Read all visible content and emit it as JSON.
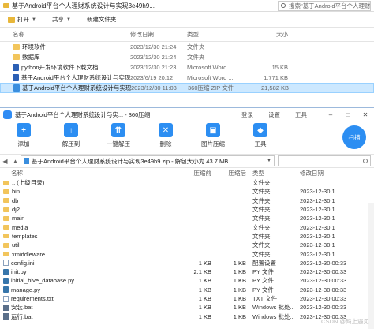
{
  "explorer": {
    "title": "基于Android平台个人理财系统设计与实现3e49h9...",
    "search_placeholder": "搜索\"基于Android平台个人理财系统...",
    "toolbar": {
      "open": "打开",
      "share": "共享",
      "new_folder": "新建文件夹"
    },
    "columns": {
      "name": "名称",
      "date": "修改日期",
      "type": "类型",
      "size": "大小"
    },
    "rows": [
      {
        "name": "环境软件",
        "date": "2023/12/30 21:24",
        "type": "文件夹",
        "size": "",
        "icon": "folder-icon"
      },
      {
        "name": "数据库",
        "date": "2023/12/30 21:24",
        "type": "文件夹",
        "size": "",
        "icon": "folder-icon"
      },
      {
        "name": "python开发环境软件下载文档",
        "date": "2023/12/30 21:23",
        "type": "Microsoft Word ...",
        "size": "15 KB",
        "icon": "word-icon"
      },
      {
        "name": "基于Android平台个人理财系统设计与实现...",
        "date": "2023/6/19 20:12",
        "type": "Microsoft Word ...",
        "size": "1,771 KB",
        "icon": "word-icon"
      },
      {
        "name": "基于Android平台个人理财系统设计与实现...",
        "date": "2023/12/30 11:03",
        "type": "360压缩 ZIP 文件",
        "size": "21,582 KB",
        "icon": "zip-icon",
        "selected": true
      }
    ]
  },
  "zip": {
    "title": "基于Android平台个人理财系统设计与实... - 360压缩",
    "menu": {
      "login": "登录",
      "settings": "设置",
      "tools": "工具"
    },
    "toolbar": [
      {
        "label": "添加",
        "icon": "add-icon"
      },
      {
        "label": "解压到",
        "icon": "extract-to-icon"
      },
      {
        "label": "一键解压",
        "icon": "one-click-extract-icon"
      },
      {
        "label": "删除",
        "icon": "delete-icon"
      },
      {
        "label": "图片压缩",
        "icon": "image-compress-icon"
      },
      {
        "label": "工具",
        "icon": "tools-icon"
      }
    ],
    "scan_label": "扫描",
    "path": "基于Android平台个人理财系统设计与实现3e49h9.zip - 解包大小为 43.7 MB",
    "columns": {
      "name": "名称",
      "compressed": "压缩前",
      "original": "压缩后",
      "type": "类型",
      "modified": "修改日期"
    },
    "rows": [
      {
        "name": ".. (上级目录)",
        "compressed": "",
        "original": "",
        "type": "文件夹",
        "modified": "",
        "icon": "folder"
      },
      {
        "name": "bin",
        "compressed": "",
        "original": "",
        "type": "文件夹",
        "modified": "2023-12-30 1",
        "icon": "folder"
      },
      {
        "name": "db",
        "compressed": "",
        "original": "",
        "type": "文件夹",
        "modified": "2023-12-30 1",
        "icon": "folder"
      },
      {
        "name": "dj2",
        "compressed": "",
        "original": "",
        "type": "文件夹",
        "modified": "2023-12-30 1",
        "icon": "folder"
      },
      {
        "name": "main",
        "compressed": "",
        "original": "",
        "type": "文件夹",
        "modified": "2023-12-30 1",
        "icon": "folder"
      },
      {
        "name": "media",
        "compressed": "",
        "original": "",
        "type": "文件夹",
        "modified": "2023-12-30 1",
        "icon": "folder"
      },
      {
        "name": "templates",
        "compressed": "",
        "original": "",
        "type": "文件夹",
        "modified": "2023-12-30 1",
        "icon": "folder"
      },
      {
        "name": "util",
        "compressed": "",
        "original": "",
        "type": "文件夹",
        "modified": "2023-12-30 1",
        "icon": "folder"
      },
      {
        "name": "xmiddleware",
        "compressed": "",
        "original": "",
        "type": "文件夹",
        "modified": "2023-12-30 1",
        "icon": "folder"
      },
      {
        "name": "config.ini",
        "compressed": "1 KB",
        "original": "1 KB",
        "type": "配置设置",
        "modified": "2023-12-30 00:33",
        "icon": "file"
      },
      {
        "name": "init.py",
        "compressed": "2.1 KB",
        "original": "1 KB",
        "type": "PY 文件",
        "modified": "2023-12-30 00:33",
        "icon": "py"
      },
      {
        "name": "initial_hive_database.py",
        "compressed": "1 KB",
        "original": "1 KB",
        "type": "PY 文件",
        "modified": "2023-12-30 00:33",
        "icon": "py"
      },
      {
        "name": "manage.py",
        "compressed": "1 KB",
        "original": "1 KB",
        "type": "PY 文件",
        "modified": "2023-12-30 00:33",
        "icon": "py"
      },
      {
        "name": "requirements.txt",
        "compressed": "1 KB",
        "original": "1 KB",
        "type": "TXT 文件",
        "modified": "2023-12-30 00:33",
        "icon": "file"
      },
      {
        "name": "安装.bat",
        "compressed": "1 KB",
        "original": "1 KB",
        "type": "Windows 批处...",
        "modified": "2023-12-30 00:33",
        "icon": "bat"
      },
      {
        "name": "运行.bat",
        "compressed": "1 KB",
        "original": "1 KB",
        "type": "Windows 批处...",
        "modified": "2023-12-30 00:33",
        "icon": "bat"
      }
    ],
    "watermark": "CSDN @码上遇见"
  }
}
